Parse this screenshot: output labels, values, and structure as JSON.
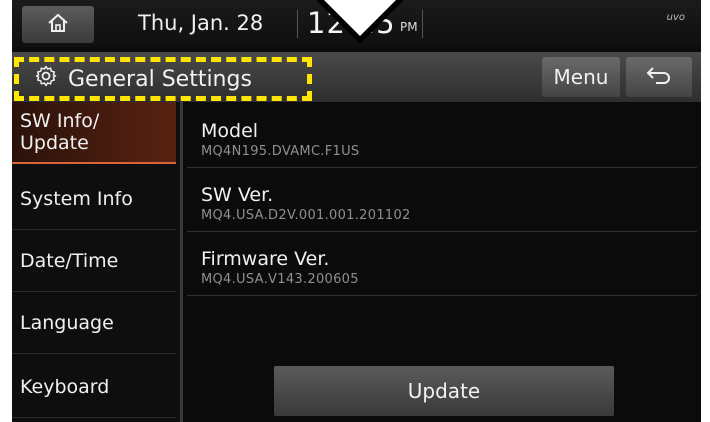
{
  "statusbar": {
    "home_icon": "home-icon",
    "date": "Thu, Jan. 28",
    "time": "12:25",
    "ampm": "PM",
    "indicator": "uvo"
  },
  "header": {
    "title": "General Settings",
    "settings_icon": "gear-icon",
    "menu_label": "Menu",
    "back_icon": "back-arrow-icon",
    "highlight_color": "#ffe600"
  },
  "sidebar": {
    "items": [
      {
        "label": "SW Info/\nUpdate",
        "active": true
      },
      {
        "label": "System Info",
        "active": false
      },
      {
        "label": "Date/Time",
        "active": false
      },
      {
        "label": "Language",
        "active": false
      },
      {
        "label": "Keyboard",
        "active": false
      }
    ],
    "active_color": "#d9643a"
  },
  "main": {
    "rows": [
      {
        "title": "Model",
        "value": "MQ4N195.DVAMC.F1US"
      },
      {
        "title": "SW Ver.",
        "value": "MQ4.USA.D2V.001.001.201102"
      },
      {
        "title": "Firmware Ver.",
        "value": "MQ4.USA.V143.200605"
      }
    ],
    "update_label": "Update"
  }
}
